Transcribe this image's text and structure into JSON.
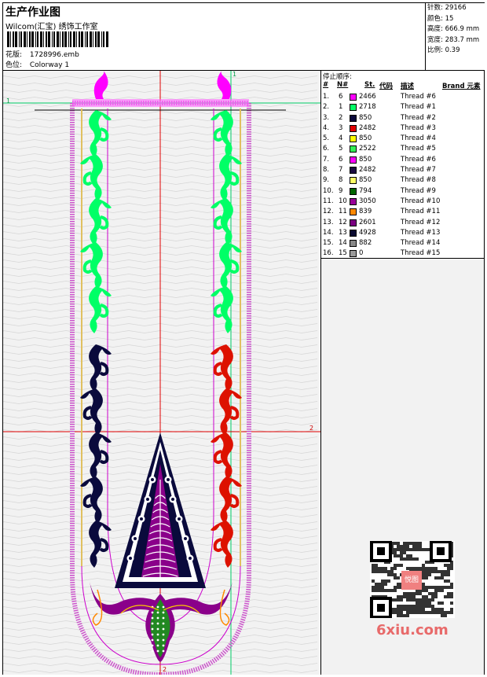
{
  "header": {
    "title": "生产作业图",
    "subtitle": "Wilcom(汇宝) 绣饰工作室",
    "design_label": "花版:",
    "design_value": "1728996.emb",
    "colorway_label": "色位:",
    "colorway_value": "Colorway 1"
  },
  "stats": {
    "stitches": "针数: 29166",
    "colors": "颜色: 15",
    "height": "高度: 666.9 mm",
    "width": "宽度: 283.7 mm",
    "scale": "比例: 0.39"
  },
  "threads": {
    "title": "停止顺序:",
    "headers": {
      "idx": "#",
      "no": "N#",
      "st": "St.",
      "code": "代码",
      "desc": "描述",
      "brand": "Brand 元素"
    },
    "rows": [
      {
        "idx": "1.",
        "no": "6",
        "color": "#ff00ff",
        "code": "2466",
        "desc": "Thread #6"
      },
      {
        "idx": "2.",
        "no": "1",
        "color": "#00ff66",
        "code": "2718",
        "desc": "Thread #1"
      },
      {
        "idx": "3.",
        "no": "2",
        "color": "#0a0a3c",
        "code": "850",
        "desc": "Thread #2"
      },
      {
        "idx": "4.",
        "no": "3",
        "color": "#e00000",
        "code": "2482",
        "desc": "Thread #3"
      },
      {
        "idx": "5.",
        "no": "4",
        "color": "#ffff00",
        "code": "850",
        "desc": "Thread #4"
      },
      {
        "idx": "6.",
        "no": "5",
        "color": "#33ee55",
        "code": "2522",
        "desc": "Thread #5"
      },
      {
        "idx": "7.",
        "no": "6",
        "color": "#ff00ff",
        "code": "850",
        "desc": "Thread #6"
      },
      {
        "idx": "8.",
        "no": "7",
        "color": "#1a0a40",
        "code": "2482",
        "desc": "Thread #7"
      },
      {
        "idx": "9.",
        "no": "8",
        "color": "#ffff66",
        "code": "850",
        "desc": "Thread #8"
      },
      {
        "idx": "10.",
        "no": "9",
        "color": "#006600",
        "code": "794",
        "desc": "Thread #9"
      },
      {
        "idx": "11.",
        "no": "10",
        "color": "#990099",
        "code": "3050",
        "desc": "Thread #10"
      },
      {
        "idx": "12.",
        "no": "11",
        "color": "#ff8800",
        "code": "839",
        "desc": "Thread #11"
      },
      {
        "idx": "13.",
        "no": "12",
        "color": "#7a0080",
        "code": "2601",
        "desc": "Thread #12"
      },
      {
        "idx": "14.",
        "no": "13",
        "color": "#0a0a30",
        "code": "4928",
        "desc": "Thread #13"
      },
      {
        "idx": "15.",
        "no": "14",
        "color": "#888888",
        "code": "882",
        "desc": "Thread #14"
      },
      {
        "idx": "16.",
        "no": "15",
        "color": "#999999",
        "code": "0",
        "desc": "Thread #15"
      }
    ]
  },
  "canvas": {
    "axis_top": "1",
    "axis_left": "1",
    "axis_right": "2",
    "axis_bottom": "2"
  },
  "watermark": {
    "text": "6xiu.com",
    "qr_label": "悦图"
  },
  "colors": {
    "magenta": "#ff00ff",
    "green": "#00ff66",
    "navy": "#0a0a3c",
    "red": "#dd1100",
    "purple": "#8a008a",
    "guide_red": "#e00000",
    "guide_green": "#00cc66"
  }
}
